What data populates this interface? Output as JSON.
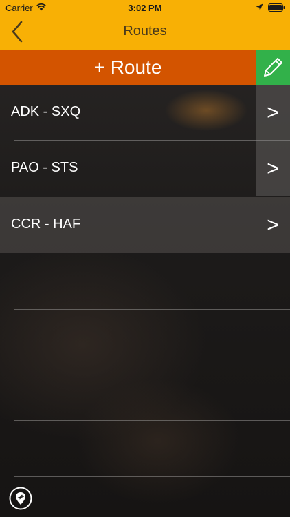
{
  "status_bar": {
    "carrier": "Carrier",
    "time": "3:02 PM"
  },
  "nav": {
    "title": "Routes"
  },
  "actions": {
    "add_route_label": "+ Route"
  },
  "routes": [
    {
      "label": "ADK - SXQ",
      "chevron": ">"
    },
    {
      "label": "PAO - STS",
      "chevron": ">"
    },
    {
      "label": "CCR - HAF",
      "chevron": ">"
    }
  ],
  "icons": {
    "back": "chevron-left-icon",
    "edit": "pencil-icon",
    "map": "map-pin-plane-icon"
  },
  "colors": {
    "nav_bar": "#f8b005",
    "add_bar": "#d35400",
    "edit_button": "#32b14a",
    "text": "#ffffff"
  }
}
